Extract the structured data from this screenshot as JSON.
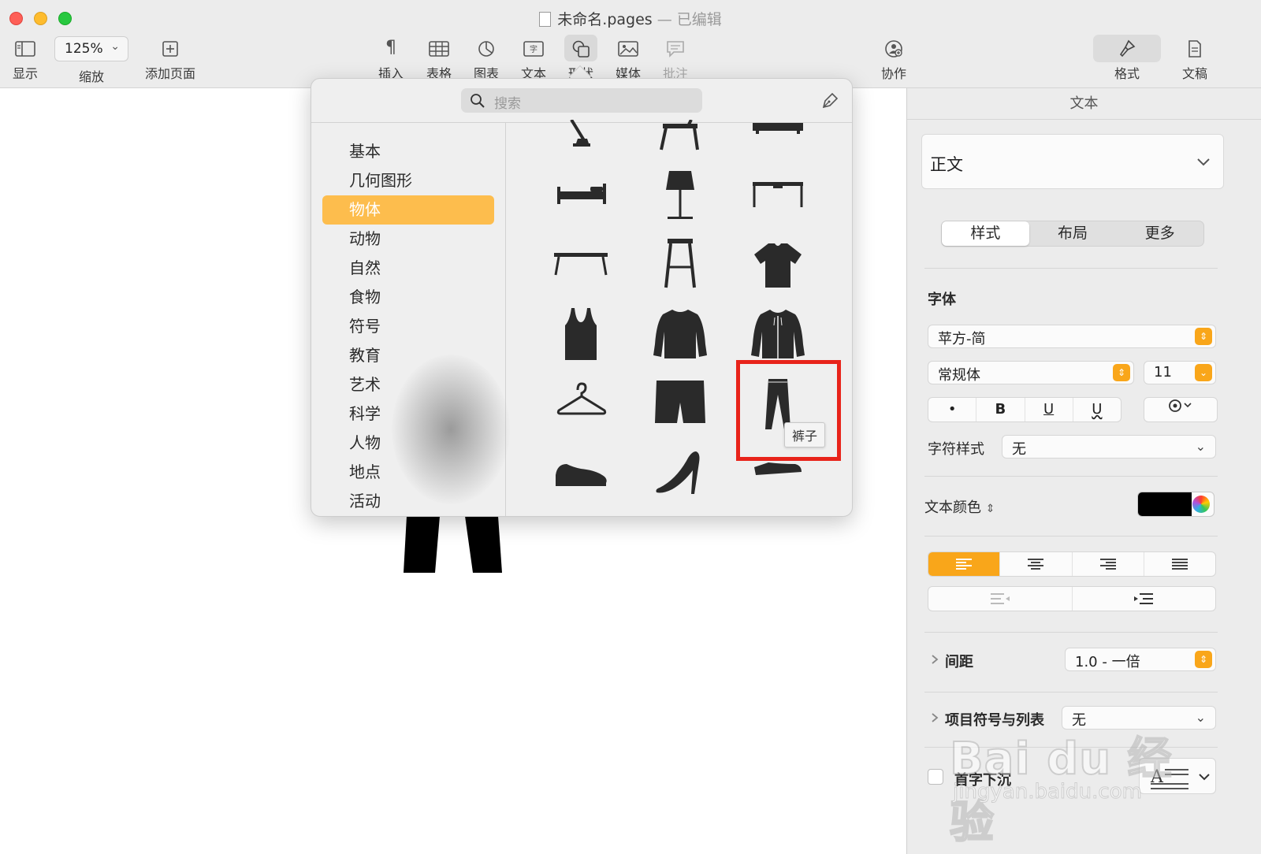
{
  "window": {
    "title": "未命名.pages",
    "separator": "—",
    "status": "已编辑"
  },
  "toolbar": {
    "view_label": "显示",
    "zoom_value": "125%",
    "zoom_label": "缩放",
    "add_page_label": "添加页面",
    "insert_label": "插入",
    "table_label": "表格",
    "chart_label": "图表",
    "text_label": "文本",
    "shape_label": "形状",
    "media_label": "媒体",
    "comment_label": "批注",
    "collaborate_label": "协作",
    "format_label": "格式",
    "document_label": "文稿"
  },
  "shape_popover": {
    "search_placeholder": "搜索",
    "categories": [
      {
        "label": "基本",
        "selected": false
      },
      {
        "label": "几何图形",
        "selected": false
      },
      {
        "label": "物体",
        "selected": true
      },
      {
        "label": "动物",
        "selected": false
      },
      {
        "label": "自然",
        "selected": false
      },
      {
        "label": "食物",
        "selected": false
      },
      {
        "label": "符号",
        "selected": false
      },
      {
        "label": "教育",
        "selected": false
      },
      {
        "label": "艺术",
        "selected": false
      },
      {
        "label": "科学",
        "selected": false
      },
      {
        "label": "人物",
        "selected": false
      },
      {
        "label": "地点",
        "selected": false
      },
      {
        "label": "活动",
        "selected": false
      }
    ],
    "shapes": [
      "desk-lamp-icon",
      "chair-icon",
      "sofa-icon",
      "bed-icon",
      "floor-lamp-icon",
      "desk-icon",
      "coffee-table-icon",
      "bar-stool-icon",
      "t-shirt-icon",
      "tank-top-icon",
      "sweater-icon",
      "hoodie-icon",
      "hanger-icon",
      "shorts-icon",
      "pants-icon",
      "sneaker-icon",
      "high-heel-icon",
      "dress-shoe-icon"
    ],
    "tooltip": "裤子",
    "highlight_color": "#e8231a",
    "selected_color": "#fdbd4d"
  },
  "inspector": {
    "title": "文本",
    "paragraph_style": "正文",
    "tabs": [
      {
        "label": "样式",
        "active": true
      },
      {
        "label": "布局",
        "active": false
      },
      {
        "label": "更多",
        "active": false
      }
    ],
    "font_section": "字体",
    "font_family": "苹方-简",
    "font_typeface": "常规体",
    "font_size": "11",
    "style_buttons": {
      "bullet": "•",
      "bold": "B",
      "underline": "U",
      "strikethrough": "U"
    },
    "char_style_label": "字符样式",
    "char_style_value": "无",
    "text_color_label": "文本颜色",
    "text_color": "#000000",
    "spacing_label": "间距",
    "spacing_value": "1.0 - 一倍",
    "bullets_label": "项目符号与列表",
    "bullets_value": "无",
    "dropcap_label": "首字下沉",
    "accent_color": "#f9a61a"
  },
  "watermark": {
    "brand": "Bai du 经验",
    "url": "jingyan.baidu.com"
  }
}
